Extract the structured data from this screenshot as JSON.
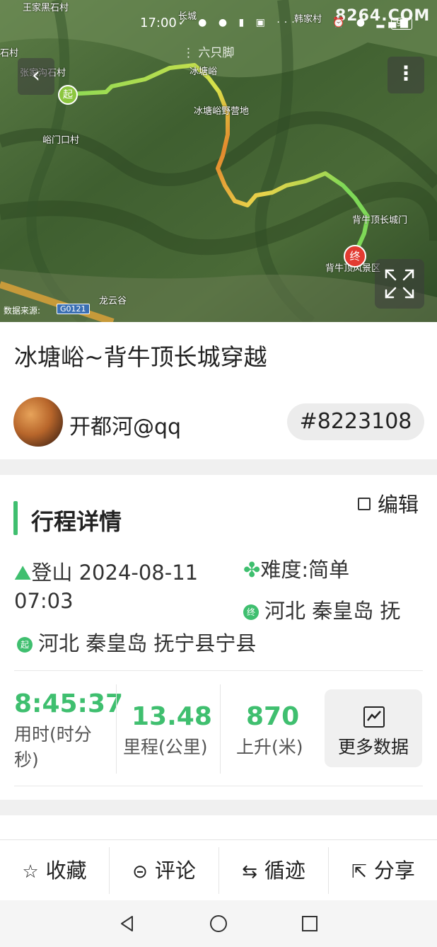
{
  "status_bar": {
    "time": "17:00",
    "battery": "93",
    "watermark": "8264.COM"
  },
  "map": {
    "brand": "六只脚",
    "source_label": "数据来源:",
    "road_label": "G0121",
    "start_marker": "起",
    "end_marker": "终",
    "labels": {
      "village_top_left": "王家黑石村",
      "village_left": "石村",
      "village_left2": "张家沟石村",
      "village_mid_left": "峪门口村",
      "place_top": "长城",
      "place_top2": "冰塘峪",
      "camp": "冰塘峪野营地",
      "place_right": "背牛顶长城门",
      "scenic": "背牛顶风景区",
      "place_bottom": "龙云谷",
      "place_top_right": "韩家村"
    }
  },
  "trip": {
    "title": "冰塘峪~背牛顶长城穿越",
    "user_name": "开都河@qq",
    "trip_id": "#8223108"
  },
  "details": {
    "section_title": "行程详情",
    "edit_label": "编辑",
    "activity_line1": "登山 2024-08-11",
    "activity_line2": "07:03",
    "difficulty": "难度:简单",
    "end_location": "河北 秦皇岛 抚",
    "start_location": "河北 秦皇岛 抚宁县宁县",
    "start_badge": "起",
    "end_badge": "终"
  },
  "stats": {
    "duration_value": "8:45:37",
    "duration_label": "用时(时分秒)",
    "distance_value": "13.48",
    "distance_label": "里程(公里)",
    "ascent_value": "870",
    "ascent_label": "上升(米)",
    "more_label": "更多数据"
  },
  "actions": {
    "favorite": "收藏",
    "comment": "评论",
    "follow_track": "循迹",
    "share": "分享"
  },
  "colors": {
    "accent": "#3fbf6f",
    "track_start": "#8cc63f",
    "track_mid": "#e48a2e",
    "end_marker": "#e23b32"
  }
}
